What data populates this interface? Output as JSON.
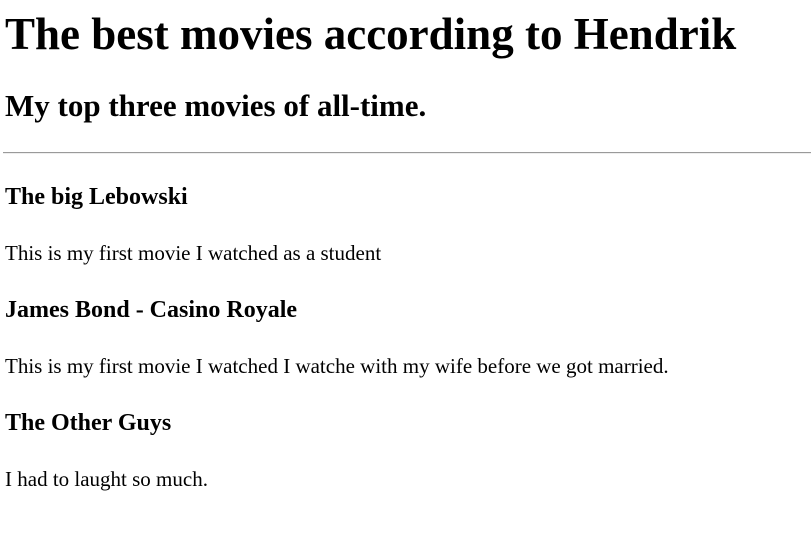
{
  "page": {
    "title": "The best movies according to Hendrik",
    "subtitle": "My top three movies of all-time."
  },
  "movies": [
    {
      "title": "The big Lebowski",
      "description": "This is my first movie I watched as a student"
    },
    {
      "title": "James Bond - Casino Royale",
      "description": "This is my first movie I watched I watche with my wife before we got married."
    },
    {
      "title": "The Other Guys",
      "description": "I had to laught so much."
    }
  ]
}
